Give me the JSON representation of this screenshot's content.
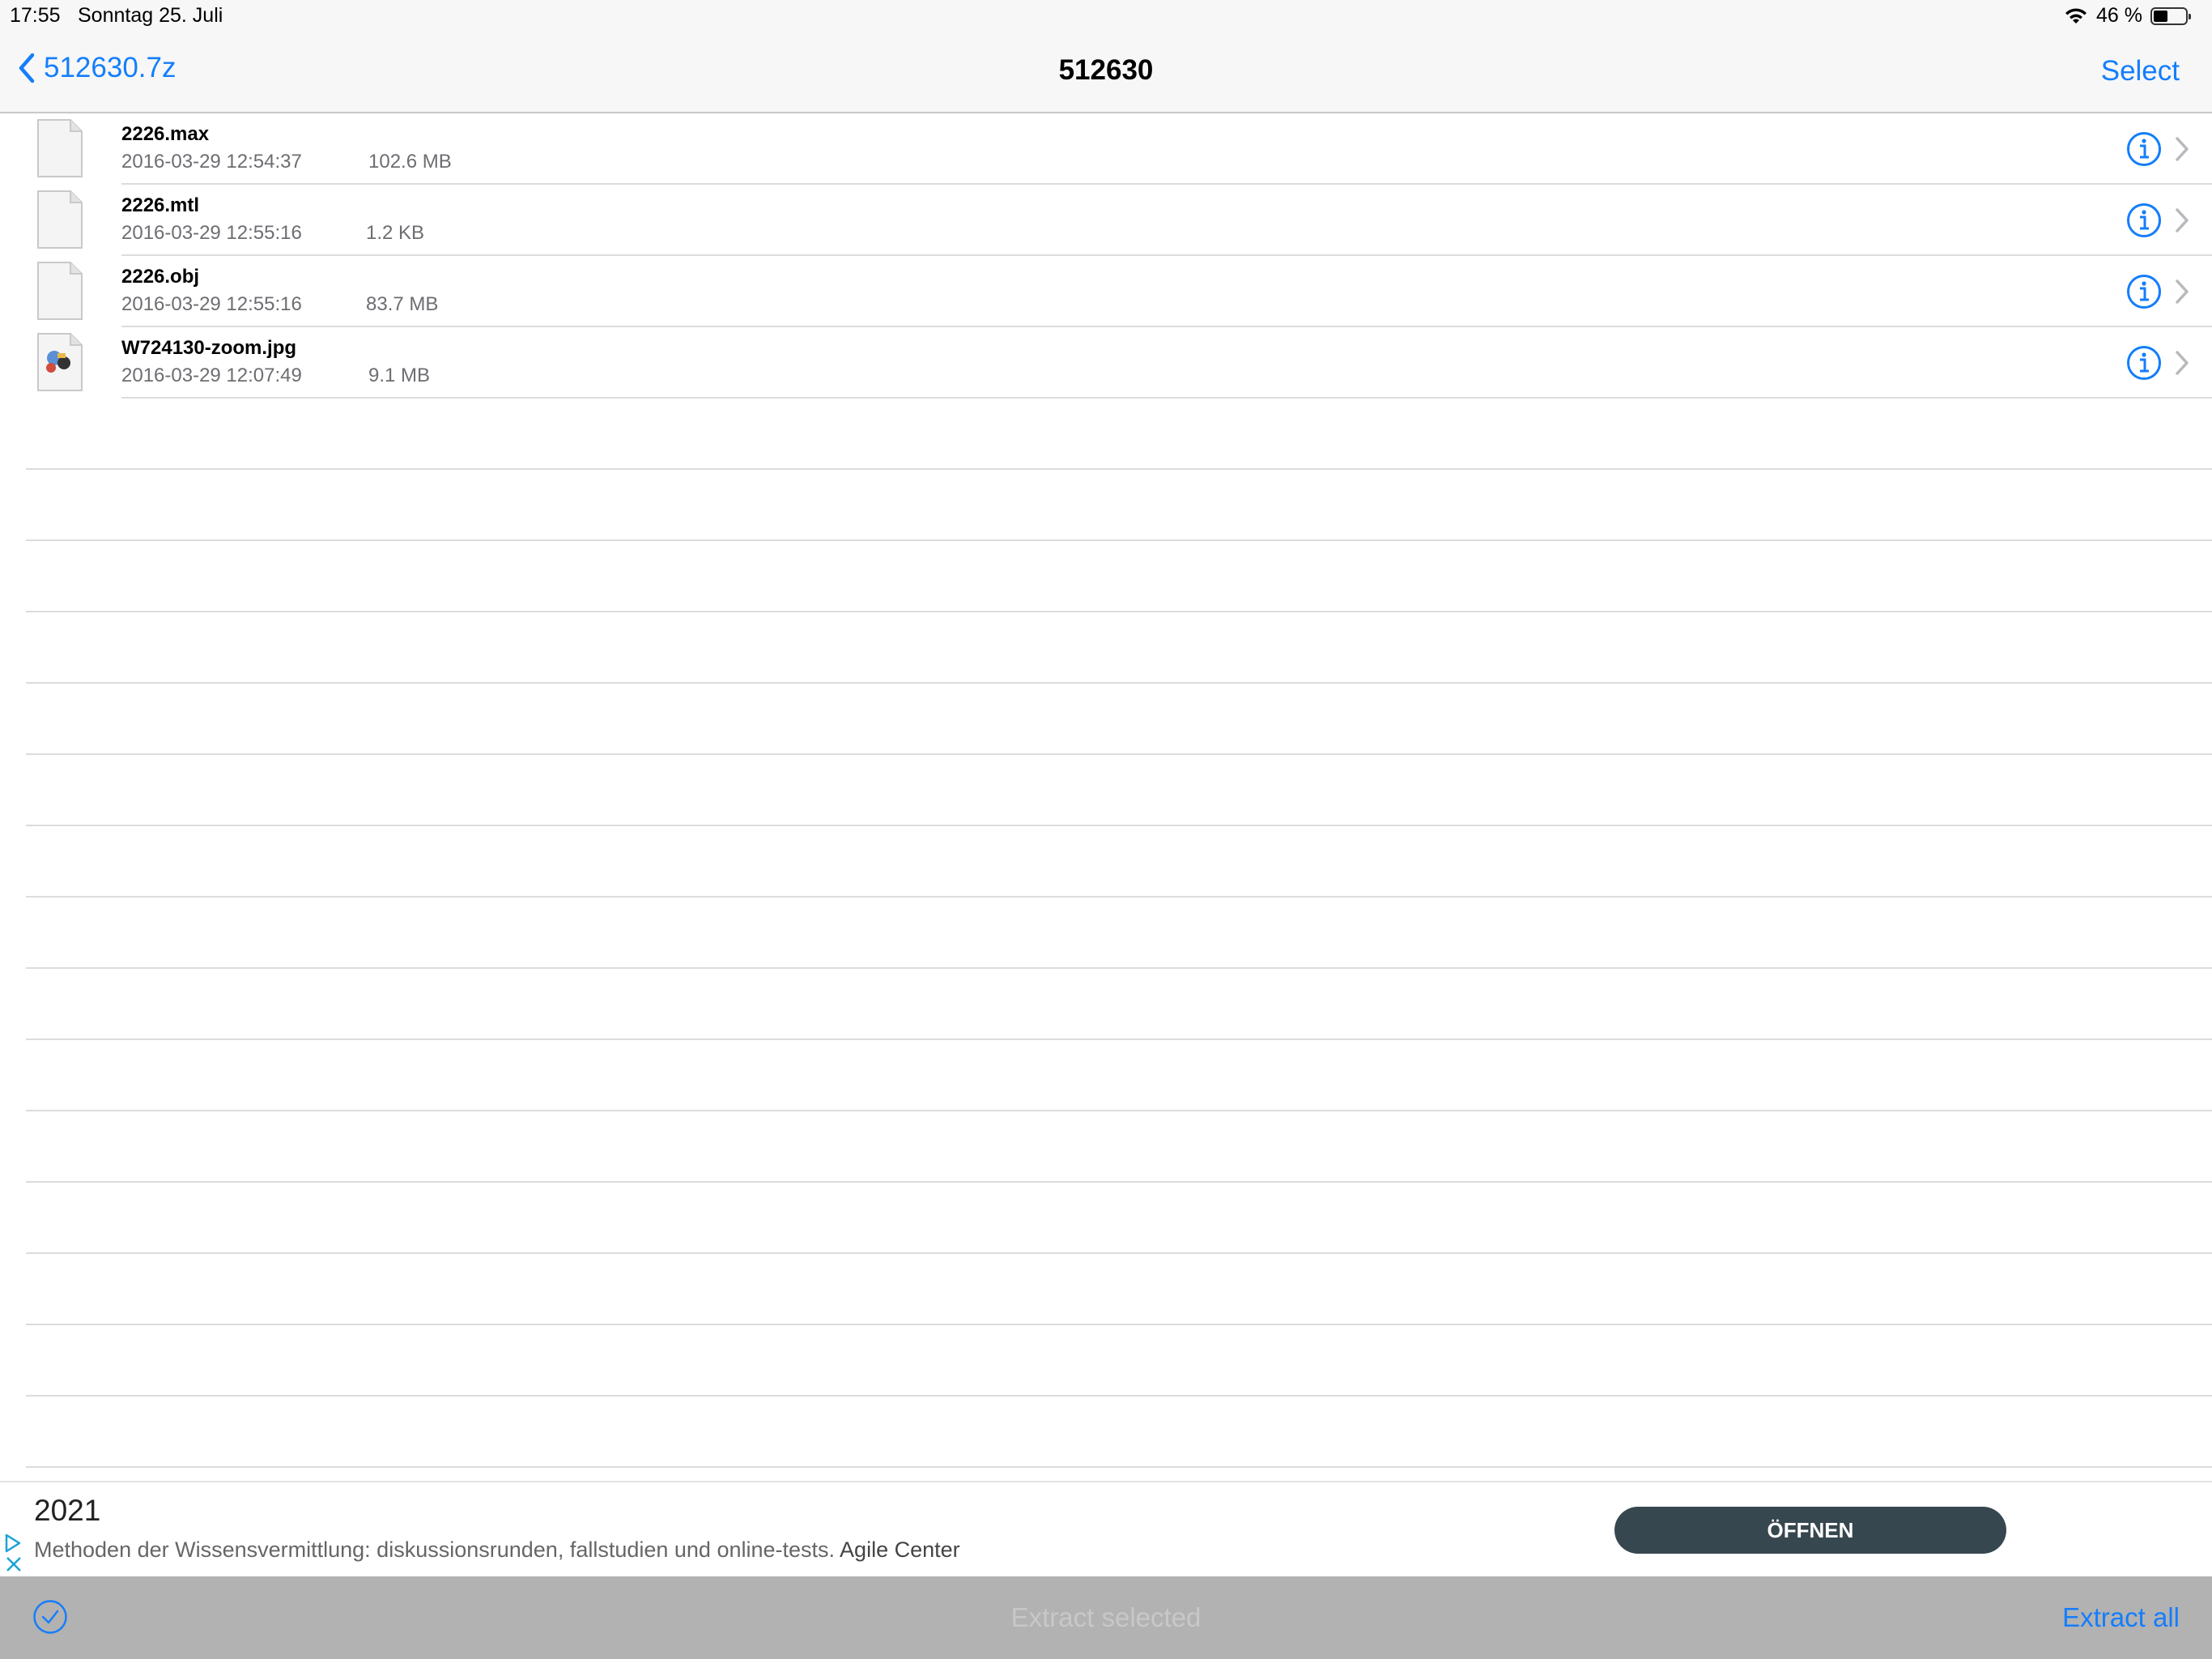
{
  "status_bar": {
    "time": "17:55",
    "date": "Sonntag 25. Juli",
    "battery": "46 %",
    "battery_level": 0.46
  },
  "nav": {
    "back_label": "512630.7z",
    "title": "512630",
    "select_label": "Select"
  },
  "files": [
    {
      "name": "2226.max",
      "date": "2016-03-29 12:54:37",
      "size": "102.6 MB",
      "icon": "generic-file-icon"
    },
    {
      "name": "2226.mtl",
      "date": "2016-03-29 12:55:16",
      "size": "1.2 KB",
      "icon": "generic-file-icon"
    },
    {
      "name": "2226.obj",
      "date": "2016-03-29 12:55:16",
      "size": "83.7 MB",
      "icon": "generic-file-icon"
    },
    {
      "name": "W724130-zoom.jpg",
      "date": "2016-03-29 12:07:49",
      "size": "9.1 MB",
      "icon": "image-file-icon"
    }
  ],
  "ad": {
    "title": "2021",
    "text": "Methoden der Wissensvermittlung: diskussionsrunden, fallstudien und online-tests.",
    "brand": "Agile Center",
    "button_label": "ÖFFNEN"
  },
  "toolbar": {
    "extract_selected_label": "Extract selected",
    "extract_all_label": "Extract all"
  },
  "colors": {
    "accent": "#147efb",
    "toolbar_bg": "#b2b2b2",
    "ad_button": "#37474f"
  }
}
